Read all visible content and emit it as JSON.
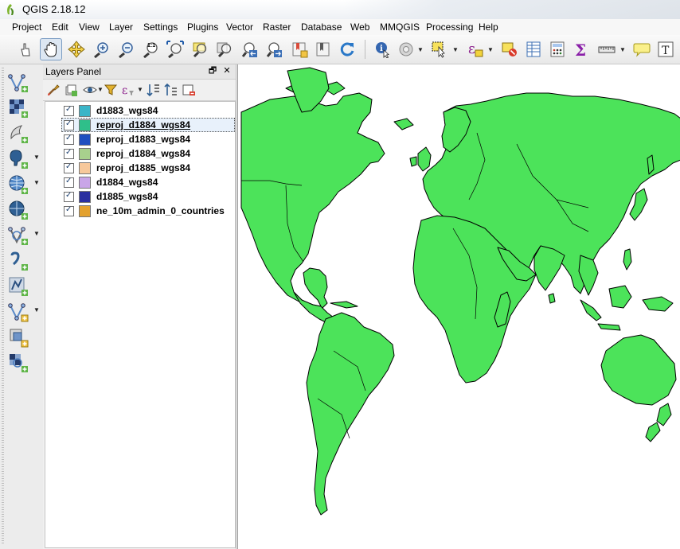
{
  "window": {
    "title": "QGIS 2.18.12"
  },
  "menu": [
    "Project",
    "Edit",
    "View",
    "Layer",
    "Settings",
    "Plugins",
    "Vector",
    "Raster",
    "Database",
    "Web",
    "MMQGIS",
    "Processing",
    "Help"
  ],
  "toolbar": {
    "icons": [
      "touch-icon",
      "pan-hand-icon",
      "pan-to-selection-icon",
      "zoom-in-icon",
      "zoom-out-icon",
      "zoom-native-icon",
      "zoom-full-icon",
      "zoom-to-selection-icon",
      "zoom-to-layer-icon",
      "zoom-last-icon",
      "zoom-next-icon",
      "new-bookmark-icon",
      "show-bookmarks-icon",
      "refresh-icon",
      "identify-icon",
      "action-icon",
      "select-features-icon",
      "select-expression-icon",
      "deselect-icon",
      "attribute-table-icon",
      "field-calculator-icon",
      "statistics-icon",
      "measure-icon",
      "map-tips-icon",
      "text-annotation-icon"
    ],
    "zoom_native_label": "1:1"
  },
  "panel": {
    "title": "Layers Panel",
    "float_glyph": "🗗",
    "close_glyph": "✕",
    "layers": [
      {
        "name": "d1883_wgs84",
        "color": "#3ab5c8",
        "checked": true,
        "selected": false
      },
      {
        "name": "reproj_d1884_wgs84",
        "color": "#2fbf8a",
        "checked": true,
        "selected": true
      },
      {
        "name": "reproj_d1883_wgs84",
        "color": "#1f4fbf",
        "checked": true,
        "selected": false
      },
      {
        "name": "reproj_d1884_wgs84",
        "color": "#a8d08d",
        "checked": true,
        "selected": false
      },
      {
        "name": "reproj_d1885_wgs84",
        "color": "#f7c89b",
        "checked": true,
        "selected": false
      },
      {
        "name": "d1884_wgs84",
        "color": "#c9a5e8",
        "checked": true,
        "selected": false
      },
      {
        "name": "d1885_wgs84",
        "color": "#2a2fa0",
        "checked": true,
        "selected": false
      },
      {
        "name": "ne_10m_admin_0_countries",
        "color": "#e3a12e",
        "checked": true,
        "selected": false
      }
    ]
  },
  "map": {
    "land_color": "#4ce35a",
    "ocean_color": "#ffffff",
    "border_color": "#000000"
  }
}
